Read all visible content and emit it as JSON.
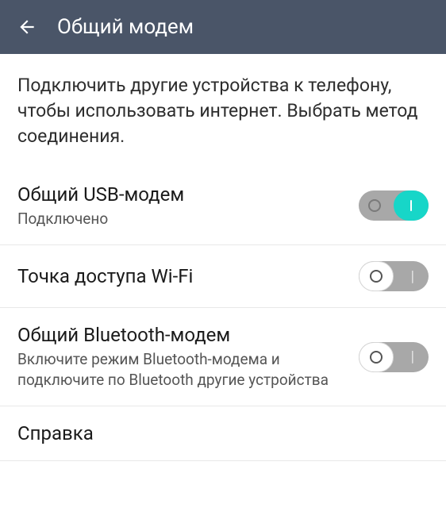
{
  "header": {
    "title": "Общий модем"
  },
  "description": "Подключить другие устройства к телефону, чтобы использовать интернет. Выбрать метод соединения.",
  "items": [
    {
      "title": "Общий USB-модем",
      "subtitle": "Подключено",
      "toggle": true
    },
    {
      "title": "Точка доступа Wi-Fi",
      "subtitle": "",
      "toggle": false
    },
    {
      "title": "Общий Bluetooth-модем",
      "subtitle": "Включите режим Bluetooth-модема и подключите по Bluetooth другие устройства",
      "toggle": false
    },
    {
      "title": "Справка",
      "subtitle": "",
      "toggle": null
    }
  ]
}
